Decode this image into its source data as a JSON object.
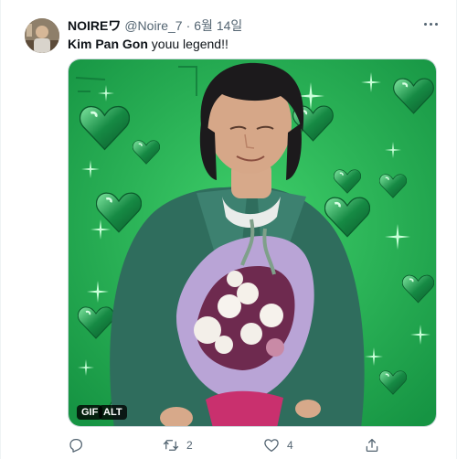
{
  "tweet": {
    "author_name": "NOIREワ",
    "author_handle": "@Noire_7",
    "separator": "·",
    "date": "6월 14일",
    "text_bold": "Kim Pan Gon",
    "text_rest": " youu legend!!",
    "media_badges": {
      "gif": "GIF",
      "alt": "ALT"
    }
  },
  "actions": {
    "reply_count": "",
    "retweet_count": "2",
    "like_count": "4"
  },
  "icons": {
    "more": "more-options-icon",
    "reply": "reply-icon",
    "retweet": "retweet-icon",
    "like": "heart-icon",
    "share": "share-icon"
  },
  "colors": {
    "text": "#0f1419",
    "secondary": "#536471",
    "media_background": "#1fa64a",
    "hearts": "#0e7a3c",
    "jacket": "#2f6d5d",
    "bouquet_wrap": "#b9a4d6"
  }
}
